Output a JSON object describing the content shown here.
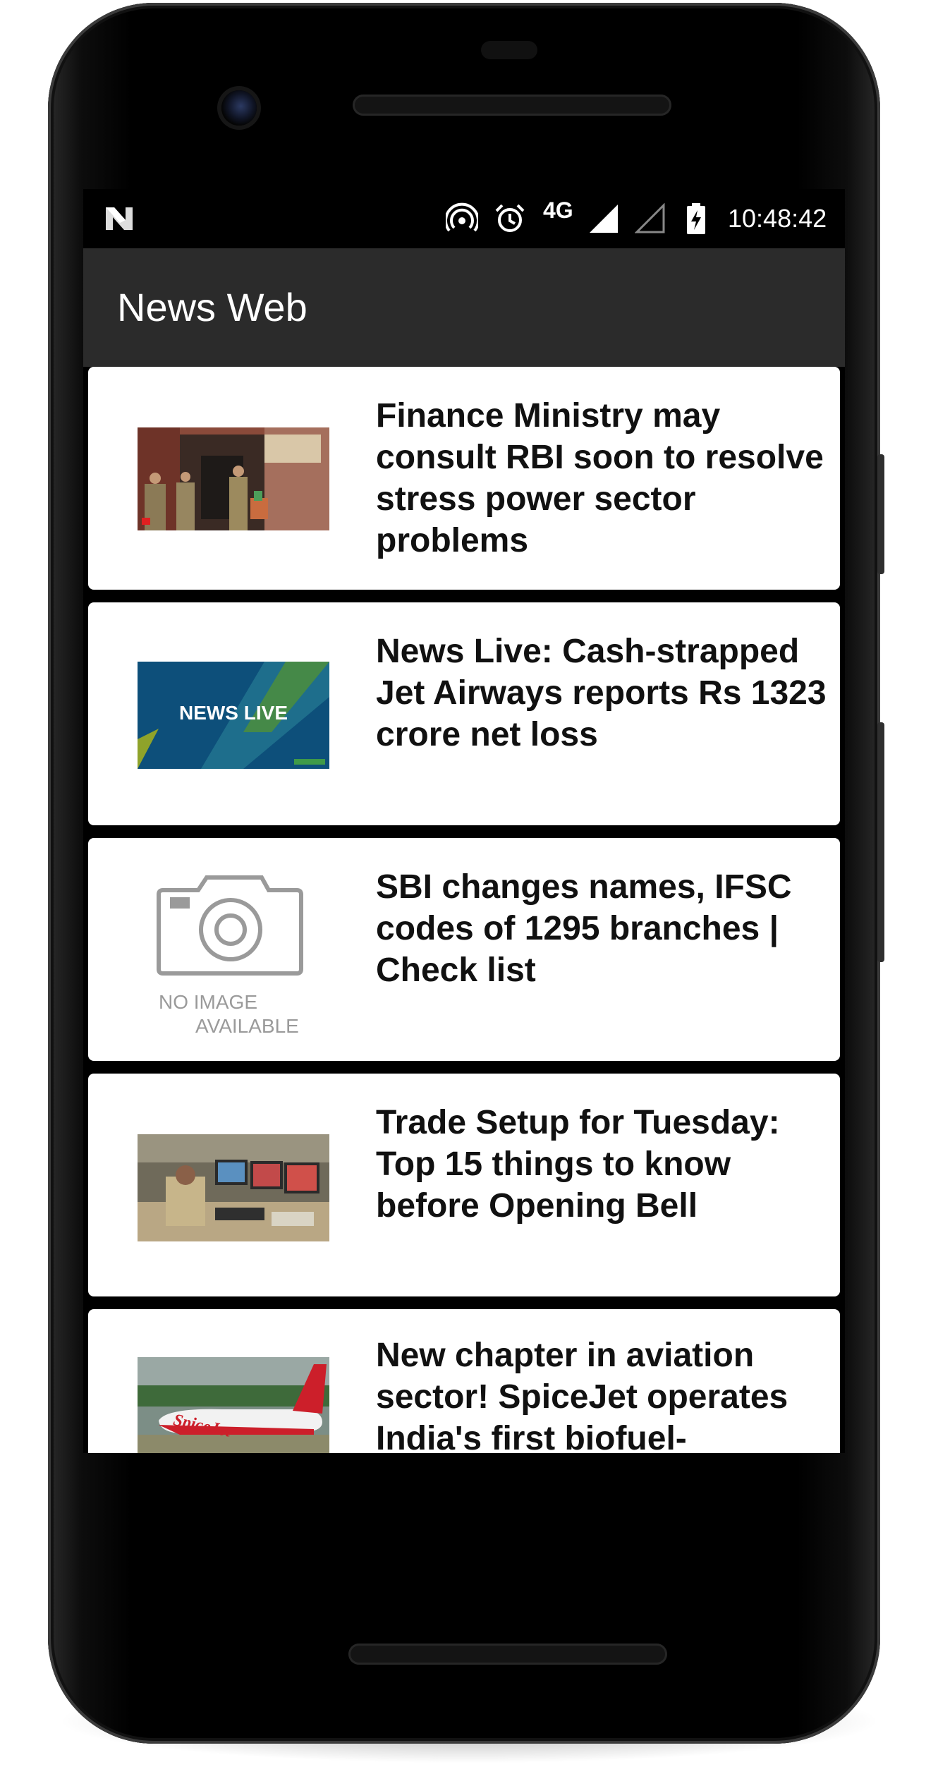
{
  "status_bar": {
    "time": "10:48:42",
    "network": "4G",
    "icons": [
      "notification-n-icon",
      "hotspot-icon",
      "alarm-icon",
      "signal-full-icon",
      "signal-empty-icon",
      "battery-charging-icon"
    ]
  },
  "app_bar": {
    "title": "News Web"
  },
  "articles": [
    {
      "headline": "Finance Ministry may consult RBI soon to resolve stress power sector problems",
      "thumbnail": "finance-ministry-photo"
    },
    {
      "headline": "News Live: Cash-strapped Jet Airways reports Rs 1323 crore net loss",
      "thumbnail": "news-live-banner",
      "thumbnail_text": "NEWS LIVE"
    },
    {
      "headline": "SBI changes names, IFSC codes of 1295 branches | Check list",
      "thumbnail": "no-image-placeholder",
      "placeholder_line1": "NO IMAGE",
      "placeholder_line2": "AVAILABLE"
    },
    {
      "headline": "Trade Setup for Tuesday: Top 15 things to know before Opening Bell",
      "thumbnail": "trading-desk-photo"
    },
    {
      "headline": "New chapter in aviation sector! SpiceJet operates India's first biofuel-",
      "thumbnail": "spicejet-plane-photo",
      "thumbnail_text": "SpiceJet"
    }
  ],
  "nav_bar": {
    "buttons": [
      "back-icon",
      "home-icon",
      "recents-icon"
    ]
  },
  "colors": {
    "app_bar": "#2b2b2b",
    "card": "#ffffff",
    "headline": "#111111",
    "screen_bg": "#000000"
  }
}
